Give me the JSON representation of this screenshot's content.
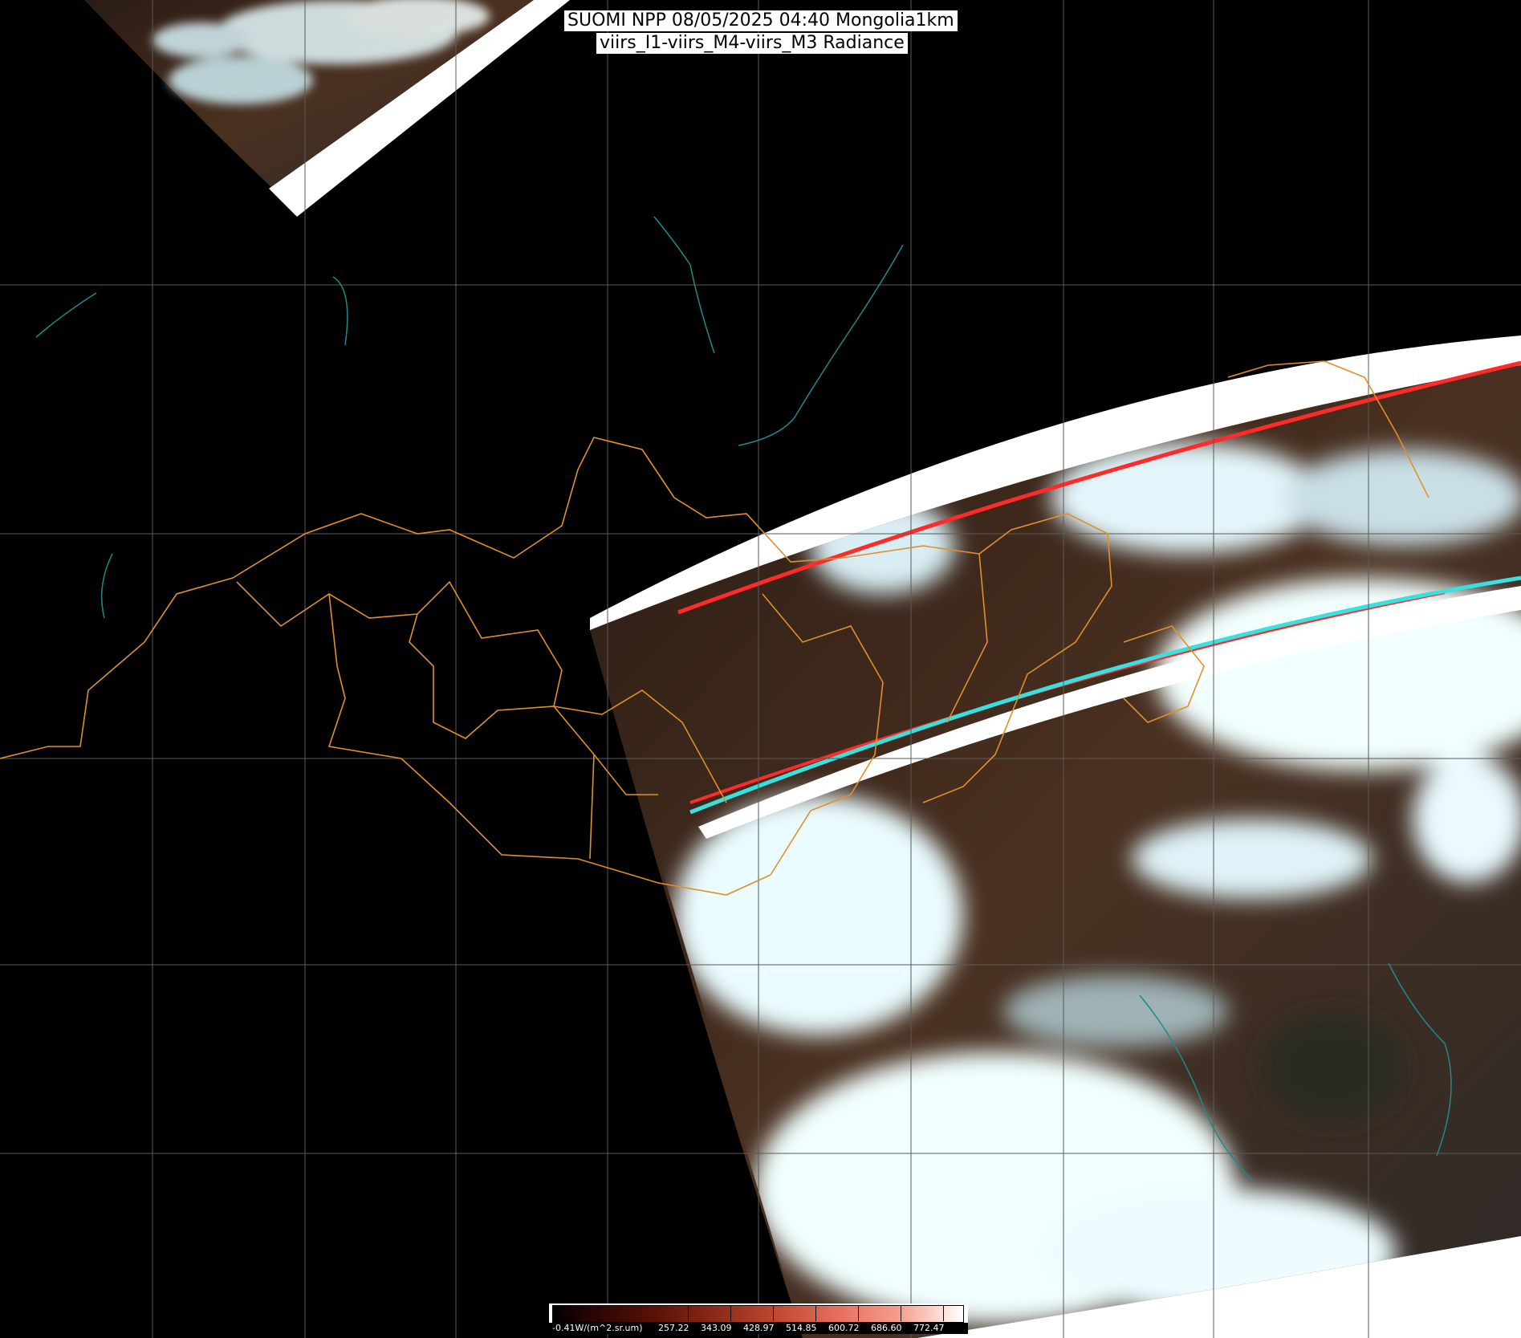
{
  "title": {
    "line1": "SUOMI NPP 08/05/2025 04:40 Mongolia1km",
    "line2": "viirs_I1-viirs_M4-viirs_M3 Radiance"
  },
  "colorbar": {
    "labels": [
      "-0.41W/(m^2.sr.um)",
      "257.22",
      "343.09",
      "428.97",
      "514.85",
      "600.72",
      "686.60",
      "772.47"
    ],
    "colors": [
      "#000000",
      "#5a1208",
      "#c04a32",
      "#f6a090",
      "#ffffff"
    ]
  },
  "map": {
    "background_color": "#000000",
    "graticule_color": "#5a5a5a",
    "border_color": "#e0902a",
    "coastline_color": "#1f8a8a",
    "swath_gap_color": "#ffffff",
    "swath_edge_red": "#ff2a2a",
    "swath_edge_cyan": "#38e0e0",
    "cloud_color": "#e8fbff",
    "land_color": "#3a2618"
  }
}
